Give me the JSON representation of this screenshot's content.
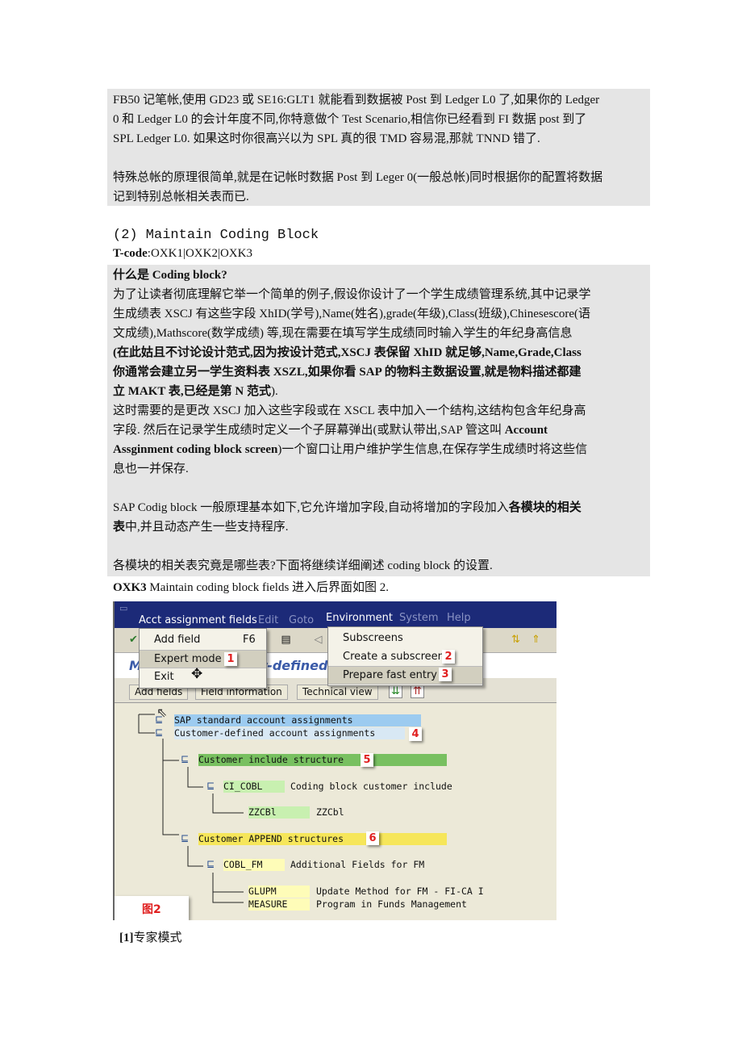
{
  "block1": {
    "lines": [
      [
        {
          "t": "FB50 记笔帐,使用 GD23 或 SE16:GLT1 就能看到数据被 Post 到 Ledger L0 了,如果你的 Ledger",
          "b": false
        }
      ],
      [
        {
          "t": "0 和 Ledger L0 的会计年度不同,你特意做个 Test Scenario,相信你已经看到 FI 数据 post 到了",
          "b": false
        }
      ],
      [
        {
          "t": "SPL Ledger L0.  如果这时你很高兴以为 SPL 真的很 TMD 容易混,那就 TNND 错了.",
          "b": false
        }
      ],
      [],
      [
        {
          "t": "特殊总帐的原理很简单,就是在记帐时数据 Post 到 Leger 0(一般总帐)同时根据你的配置将数据",
          "b": false
        }
      ],
      [
        {
          "t": "记到特别总帐相关表而已.",
          "b": false
        }
      ]
    ]
  },
  "heading": "(2) Maintain Coding Block",
  "tcode": {
    "label": "T-code",
    "value": ":OXK1|OXK2|OXK3"
  },
  "block2": {
    "lines": [
      [
        {
          "t": "什么是 Coding block?",
          "b": true
        }
      ],
      [
        {
          "t": "为了让读者彻底理解它举一个简单的例子,假设你设计了一个学生成绩管理系统,其中记录学",
          "b": false
        }
      ],
      [
        {
          "t": "生成绩表 XSCJ 有这些字段 XhID(学号),Name(姓名),grade(年级),Class(班级),Chinesescore(语",
          "b": false
        }
      ],
      [
        {
          "t": "文成绩),Mathscore(数学成绩)  等,现在需要在填写学生成绩同时输入学生的年纪身高信息",
          "b": false
        }
      ],
      [
        {
          "t": "(在此姑且不讨论设计范式,因为按设计范式,XSCJ 表保留 XhID 就足够,Name,Grade,Class",
          "b": true
        }
      ],
      [
        {
          "t": "你通常会建立另一学生资料表 XSZL,如果你看 SAP 的物料主数据设置,就是物料描述都建",
          "b": true
        }
      ],
      [
        {
          "t": "立 MAKT 表,已经是第 N 范式",
          "b": true
        },
        {
          "t": ").",
          "b": false
        }
      ],
      [
        {
          "t": "这时需要的是更改 XSCJ 加入这些字段或在 XSCL 表中加入一个结构,这结构包含年纪身高",
          "b": false
        }
      ],
      [
        {
          "t": "字段. 然后在记录学生成绩时定义一个子屏幕弹出(或默认带出,SAP 管这叫 ",
          "b": false
        },
        {
          "t": "Account",
          "b": true
        }
      ],
      [
        {
          "t": "Assginment coding block screen",
          "b": true
        },
        {
          "t": ")一个窗口让用户维护学生信息,在保存学生成绩时将这些信",
          "b": false
        }
      ],
      [
        {
          "t": "息也一并保存.",
          "b": false
        }
      ],
      [],
      [
        {
          "t": "SAP Codig block 一般原理基本如下,它允许增加字段,自动将增加的字段加入",
          "b": false
        },
        {
          "t": "各模块的相关",
          "b": true
        }
      ],
      [
        {
          "t": "表",
          "b": true
        },
        {
          "t": "中,并且动态产生一些支持程序.",
          "b": false
        }
      ],
      [],
      [
        {
          "t": "各模块的相关表究竟是哪些表?下面将继续详细阐述 coding block 的设置.",
          "b": false
        }
      ]
    ]
  },
  "oxk3": {
    "code": "OXK3",
    "text": " Maintain coding block fields 进入后界面如图 2."
  },
  "sap": {
    "menubar": [
      "Acct assignment fields",
      "Edit",
      "Goto",
      "Environment",
      "System",
      "Help"
    ],
    "screen_title": "Maintain Customer-defined Coding Block",
    "buttons": [
      "Add fields",
      "Field information",
      "Technical view"
    ],
    "left_menu": [
      {
        "label": "Add field",
        "shortcut": "F6"
      },
      {
        "label": "Expert mode",
        "badge": "1"
      },
      {
        "label": "Exit"
      }
    ],
    "right_menu": [
      {
        "label": "Subscreens"
      },
      {
        "label": "Create a subscreen",
        "badge": "2"
      },
      {
        "label": "Prepare fast entry",
        "badge": "3"
      }
    ],
    "tree": [
      {
        "label": "SAP standard account assignments"
      },
      {
        "label": "Customer-defined account assignments",
        "badge": "4"
      },
      {
        "label": "Customer include structure",
        "badge": "5"
      },
      {
        "label": "CI_COBL",
        "desc": "Coding block customer include"
      },
      {
        "label": "ZZCBl",
        "desc": "ZZCbl"
      },
      {
        "label": "Customer APPEND structures",
        "badge": "6"
      },
      {
        "label": "COBL_FM",
        "desc": "Additional Fields for FM"
      },
      {
        "label": "GLUPM",
        "desc": "Update Method for FM - FI-CA I"
      },
      {
        "label": "MEASURE",
        "desc": "Program in Funds Management"
      }
    ],
    "figure_label": "图2",
    "colors": {
      "titlebar": "#1c2a78",
      "blue_row": "#9ccbf0",
      "green_row": "#78c060",
      "yellow_row": "#f6e65a",
      "badge_text": "#e02020"
    }
  },
  "note": {
    "marker": "[1]",
    "text": "专家模式"
  }
}
